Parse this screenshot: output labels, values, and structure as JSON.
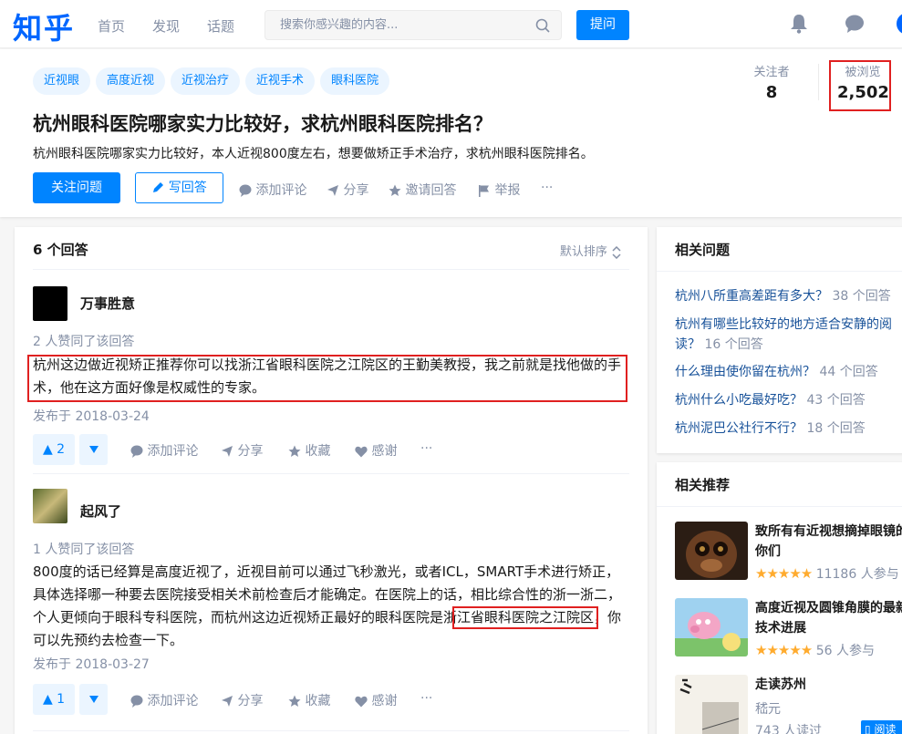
{
  "nav": {
    "logo": "知乎",
    "links": [
      "首页",
      "发现",
      "话题"
    ],
    "search_placeholder": "搜索你感兴趣的内容...",
    "ask_label": "提问"
  },
  "question": {
    "topics": [
      "近视眼",
      "高度近视",
      "近视治疗",
      "近视手术",
      "眼科医院"
    ],
    "title": "杭州眼科医院哪家实力比较好，求杭州眼科医院排名？",
    "detail": "杭州眼科医院哪家实力比较好，本人近视800度左右，想要做矫正手术治疗，求杭州眼科医院排名。",
    "follow_label": "关注问题",
    "write_label": "写回答",
    "actions": [
      "添加评论",
      "分享",
      "邀请回答",
      "举报",
      "···"
    ],
    "stats": {
      "followers_label": "关注者",
      "followers": "8",
      "views_label": "被浏览",
      "views": "2,502"
    }
  },
  "answers_card": {
    "count_label": "6 个回答",
    "sort_label": "默认排序",
    "answers": [
      {
        "author": "万事胜意",
        "upvote_note": "2 人赞同了该回答",
        "text": "杭州这边做近视矫正推荐你可以找浙江省眼科医院之江院区的王勤美教授，我之前就是找他做的手术，他在这方面好像是权威性的专家。",
        "date": "发布于 2018-03-24",
        "votes": "▲ 2",
        "actions": [
          "添加评论",
          "分享",
          "收藏",
          "感谢",
          "···"
        ]
      },
      {
        "author": "起风了",
        "upvote_note": "1 人赞同了该回答",
        "text": "800度的话已经算是高度近视了，近视目前可以通过飞秒激光，或者ICL，SMART手术进行矫正，具体选择哪一种要去医院接受相关术前检查后才能确定。在医院上的话，相比综合性的浙一浙二，个人更倾向于眼科专科医院，而杭州这边近视矫正最好的眼科医院是浙江省眼科医院之江院区，你可以先预约去检查一下。",
        "date": "发布于 2018-03-27",
        "votes": "▲ 1",
        "actions": [
          "添加评论",
          "分享",
          "收藏",
          "感谢",
          "···"
        ]
      }
    ]
  },
  "related_questions": {
    "title": "相关问题",
    "items": [
      {
        "q": "杭州八所重高差距有多大？",
        "count": "38 个回答"
      },
      {
        "q": "杭州有哪些比较好的地方适合安静的阅读？",
        "count": "16 个回答"
      },
      {
        "q": "什么理由使你留在杭州？",
        "count": "44 个回答"
      },
      {
        "q": "杭州什么小吃最好吃？",
        "count": "43 个回答"
      },
      {
        "q": "杭州泥巴公社行不行？",
        "count": "18 个回答"
      }
    ]
  },
  "related_recs": {
    "title": "相关推荐",
    "items": [
      {
        "title": "致所有有近视想摘掉眼镜的你们",
        "stars": "★★★★★",
        "meta": "11186 人参与",
        "rating_fraction": 0.9
      },
      {
        "title": "高度近视及圆锥角膜的最新技术进展",
        "stars": "★★★★★",
        "meta": "56 人参与",
        "rating_fraction": 1.0
      },
      {
        "title": "走读苏州",
        "author": "嵇元",
        "meta": "743 人读过",
        "tag": "阅读"
      }
    ]
  },
  "colors": {
    "brand": "#0066ff",
    "accent": "#0084ff",
    "muted": "#8590a6",
    "highlight": "#e02020"
  }
}
